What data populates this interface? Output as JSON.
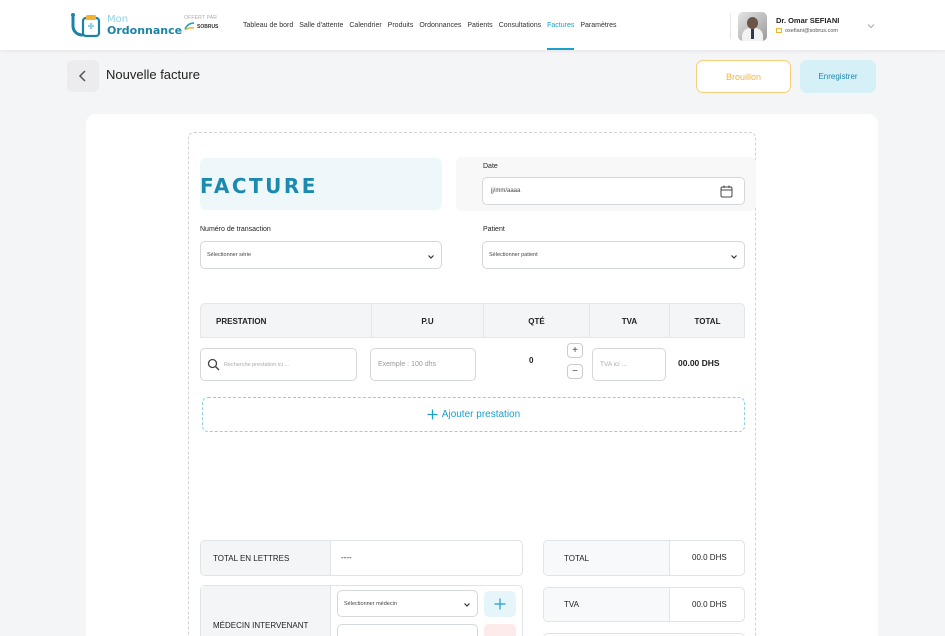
{
  "brand": {
    "line1": "Mon",
    "line2": "Ordonnance",
    "sponsor_label": "OFFERT PAR",
    "sponsor_name": "SOBRUS"
  },
  "nav": {
    "items": [
      "Tableau de bord",
      "Salle d'attente",
      "Calendrier",
      "Produits",
      "Ordonnances",
      "Patients",
      "Consultations",
      "Factures",
      "Paramètres"
    ],
    "active": "Factures"
  },
  "user": {
    "name": "Dr. Omar SEFIANI",
    "email": "osefiani@sobrus.com"
  },
  "header": {
    "title": "Nouvelle facture",
    "draft_label": "Brouillon",
    "save_label": "Enregistrer"
  },
  "invoice": {
    "title": "FACTURE",
    "date_label": "Date",
    "date_placeholder": "jj/mm/aaaa",
    "transaction_label": "Numéro de transaction",
    "transaction_placeholder": "Sélectionner série",
    "patient_label": "Patient",
    "patient_placeholder": "Sélectionner patient"
  },
  "table": {
    "columns": [
      "PRESTATION",
      "P.U",
      "QTÉ",
      "TVA",
      "TOTAL"
    ],
    "row": {
      "prestation_placeholder": "Recherche prestation ici ...",
      "pu_placeholder": "Exemple : 100 dhs",
      "qty": "0",
      "tva_placeholder": "TVA ici ...",
      "total": "00.00 DHS"
    },
    "add_label": "Ajouter prestation"
  },
  "summary": {
    "total_letters_label": "TOTAL EN LETTRES",
    "total_letters_value": "----",
    "doctor_label": "MÉDECIN INTERVENANT",
    "doctor_placeholder": "Sélectionner médecin",
    "total_label": "TOTAL",
    "total_value": "00.0 DHS",
    "tva_label": "TVA",
    "tva_value": "00.0 DHS"
  },
  "colors": {
    "accent": "#1ba0c9",
    "draft": "#f1b43a",
    "brand_dark": "#1b84a6"
  }
}
